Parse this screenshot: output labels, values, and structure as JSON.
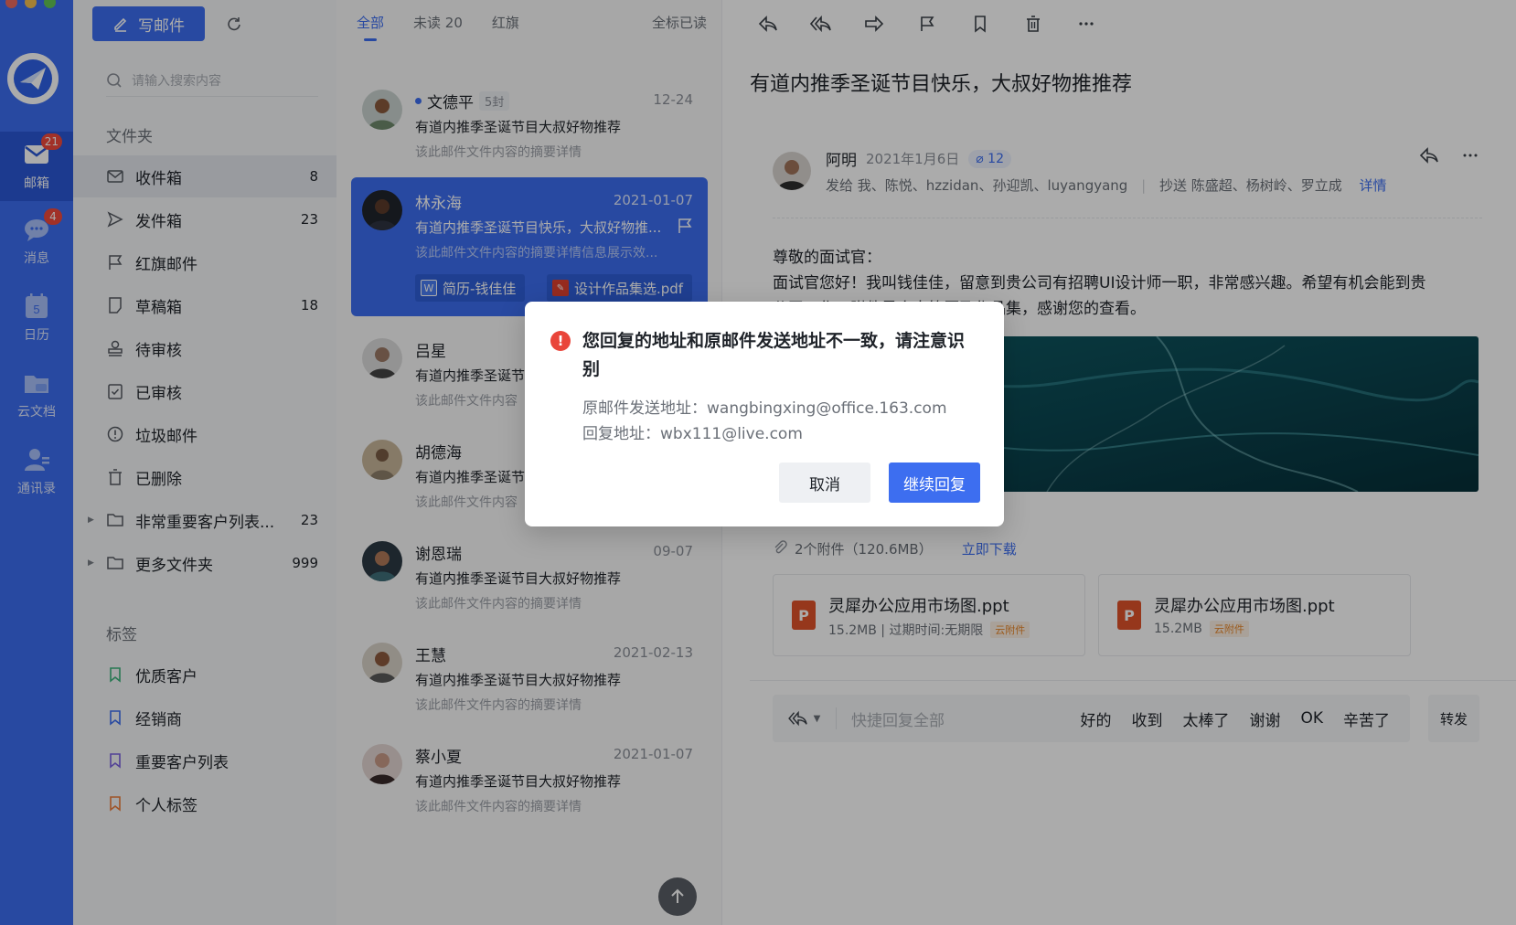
{
  "rail": {
    "items": [
      {
        "label": "邮箱",
        "badge": "21"
      },
      {
        "label": "消息",
        "badge": "4"
      },
      {
        "label": "日历",
        "day": "5"
      },
      {
        "label": "云文档"
      },
      {
        "label": "通讯录"
      }
    ]
  },
  "sidebar": {
    "compose_label": "写邮件",
    "search_placeholder": "请输入搜索内容",
    "folders_title": "文件夹",
    "folders": [
      {
        "label": "收件箱",
        "count": "8",
        "icon": "inbox-icon"
      },
      {
        "label": "发件箱",
        "count": "23",
        "icon": "send-icon"
      },
      {
        "label": "红旗邮件",
        "count": "",
        "icon": "flag-icon"
      },
      {
        "label": "草稿箱",
        "count": "18",
        "icon": "draft-icon"
      },
      {
        "label": "待审核",
        "count": "",
        "icon": "stamp-icon"
      },
      {
        "label": "已审核",
        "count": "",
        "icon": "checked-icon"
      },
      {
        "label": "垃圾邮件",
        "count": "",
        "icon": "spam-icon"
      },
      {
        "label": "已删除",
        "count": "",
        "icon": "trash-icon"
      },
      {
        "label": "非常重要客户列表...",
        "count": "23",
        "icon": "folder-icon"
      },
      {
        "label": "更多文件夹",
        "count": "999",
        "icon": "folder-icon"
      }
    ],
    "tags_title": "标签",
    "tags": [
      {
        "label": "优质客户",
        "color": "#3bb37b"
      },
      {
        "label": "经销商",
        "color": "#3d6ef0"
      },
      {
        "label": "重要客户列表",
        "color": "#7b61e0"
      },
      {
        "label": "个人标签",
        "color": "#ee7d3b"
      }
    ]
  },
  "list": {
    "tabs": [
      "全部",
      "未读 20",
      "红旗"
    ],
    "mark_all": "全标已读",
    "messages": [
      {
        "sender": "文德平",
        "count": "5封",
        "date": "12-24",
        "subject": "有道内推季圣诞节目大叔好物推荐",
        "preview": "该此邮件文件内容的摘要详情"
      },
      {
        "sender": "林永海",
        "date": "2021-01-07",
        "subject": "有道内推季圣诞节目快乐，大叔好物推...",
        "preview": "该此邮件文件内容的摘要详情信息展示效...",
        "attachments": [
          "简历-钱佳佳",
          "设计作品集选.pdf"
        ]
      },
      {
        "sender": "吕星",
        "date": "",
        "subject": "有道内推季圣诞节",
        "preview": "该此邮件文件内容"
      },
      {
        "sender": "胡德海",
        "date": "",
        "subject": "有道内推季圣诞节",
        "preview": "该此邮件文件内容"
      },
      {
        "sender": "谢恩瑞",
        "date": "09-07",
        "subject": "有道内推季圣诞节目大叔好物推荐",
        "preview": "该此邮件文件内容的摘要详情"
      },
      {
        "sender": "王慧",
        "date": "2021-02-13",
        "subject": "有道内推季圣诞节目大叔好物推荐",
        "preview": "该此邮件文件内容的摘要详情"
      },
      {
        "sender": "蔡小夏",
        "date": "2021-01-07",
        "subject": "有道内推季圣诞节目大叔好物推荐",
        "preview": "该此邮件文件内容的摘要详情"
      }
    ]
  },
  "reader": {
    "subject": "有道内推季圣诞节目快乐，大叔好物推推荐",
    "from": "阿明",
    "date": "2021年1月6日",
    "attach_count": "12",
    "to_label": "发给",
    "to": "我、陈悦、hzzidan、孙迎凯、luyangyang",
    "cc_label": "抄送",
    "cc": "陈盛超、杨树岭、罗立成",
    "details": "详情",
    "greeting": "尊敬的面试官：",
    "body_line1": "面试官您好！我叫钱佳佳，留意到贵公司有招聘UI设计师一职，非常感兴趣。希望有机会能到贵",
    "body_line2": "公司工作，附件是个人简历及作品集，感谢您的查看。",
    "attachments_summary": "2个附件（120.6MB）",
    "download_all": "立即下载",
    "attachments": [
      {
        "name": "灵犀办公应用市场图.ppt",
        "meta": "15.2MB | 过期时间:无期限",
        "tag": "云附件"
      },
      {
        "name": "灵犀办公应用市场图.ppt",
        "meta": "15.2MB",
        "tag": "云附件"
      }
    ],
    "quick_reply_placeholder": "快捷回复全部",
    "quick_replies": [
      "好的",
      "收到",
      "太棒了",
      "谢谢",
      "OK",
      "辛苦了"
    ],
    "forward": "转发"
  },
  "dialog": {
    "title": "您回复的地址和原邮件发送地址不一致，请注意识别",
    "original_label": "原邮件发送地址：",
    "original_address": "wangbingxing@office.163.com",
    "reply_label": "回复地址：",
    "reply_address": "wbx111@live.com",
    "cancel": "取消",
    "confirm": "继续回复"
  }
}
